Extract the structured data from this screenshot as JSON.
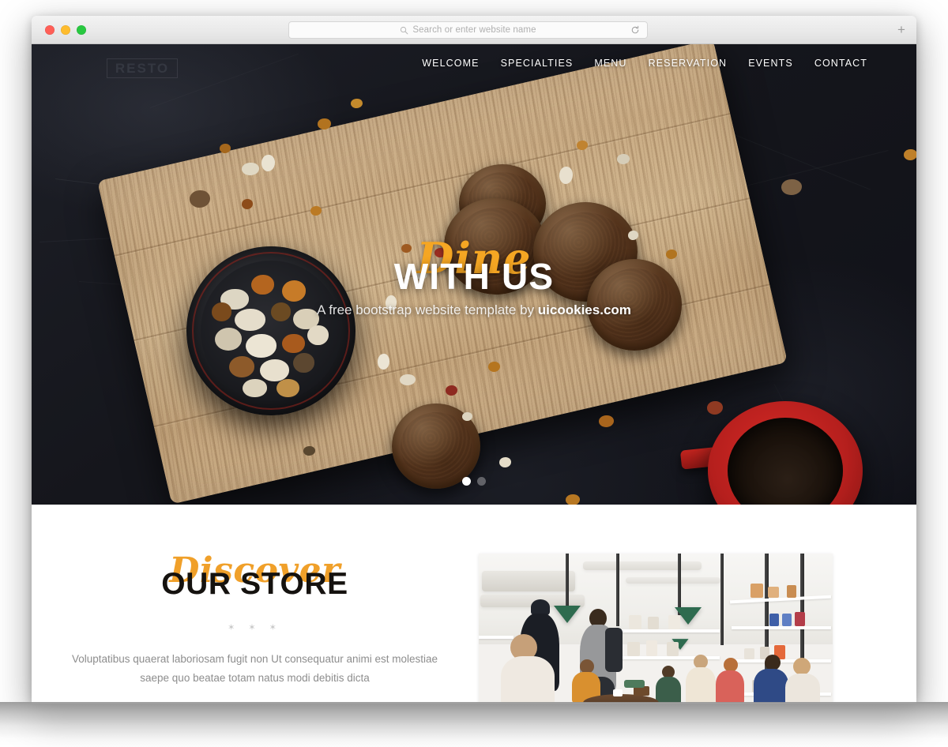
{
  "browser": {
    "traffic_lights": [
      {
        "name": "close",
        "color": "#ff5f57"
      },
      {
        "name": "minimize",
        "color": "#febc2e"
      },
      {
        "name": "zoom",
        "color": "#28c840"
      }
    ],
    "address_bar": {
      "placeholder": "Search or enter website name",
      "value": "",
      "search_icon": "search-icon",
      "reload_icon": "reload-icon"
    },
    "new_tab_label": "+"
  },
  "site": {
    "logo": "RESTO",
    "nav": [
      {
        "label": "WELCOME"
      },
      {
        "label": "SPECIALTIES"
      },
      {
        "label": "MENU"
      },
      {
        "label": "RESERVATION"
      },
      {
        "label": "EVENTS"
      },
      {
        "label": "CONTACT"
      }
    ],
    "hero": {
      "script": "Dine",
      "title": "WITH US",
      "subtitle_prefix": "A free bootstrap website template by ",
      "subtitle_brand": "uicookies.com",
      "accent_color": "#f5a623",
      "carousel": {
        "slide_count": 2,
        "active_index": 0
      }
    },
    "store": {
      "script": "Discover",
      "title": "OUR STORE",
      "divider": "✶ ✶ ✶",
      "body": "Voluptatibus quaerat laboriosam fugit non Ut consequatur animi est molestiae saepe quo beatae totam natus modi debitis dicta",
      "photo_alt": "cafe-interior-photo"
    }
  }
}
